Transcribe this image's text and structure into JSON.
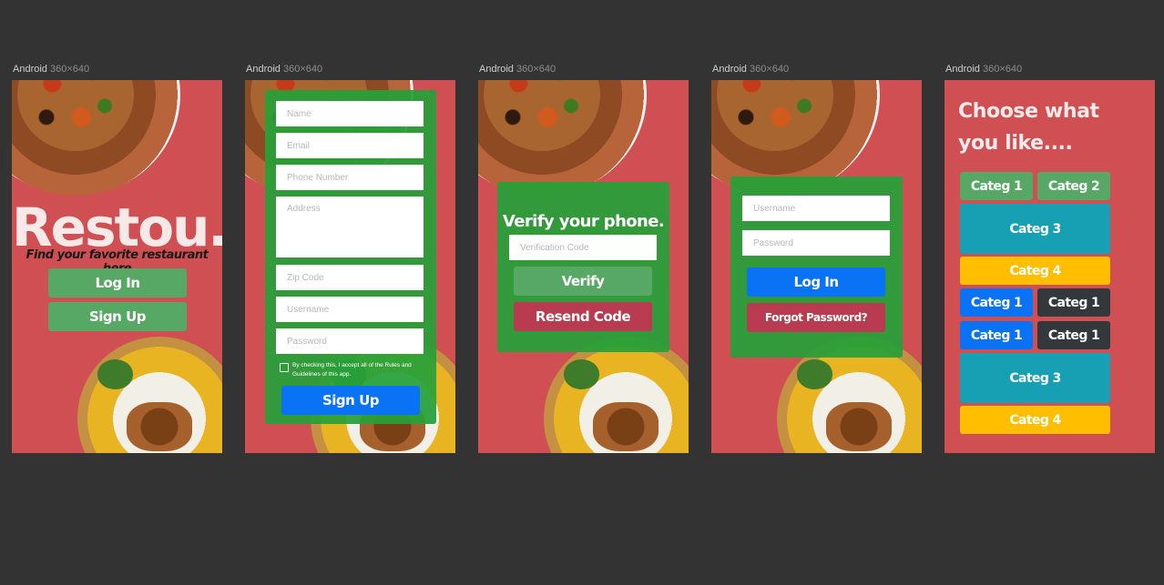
{
  "frames": [
    {
      "device": "Android",
      "size": "360×640"
    },
    {
      "device": "Android",
      "size": "360×640"
    },
    {
      "device": "Android",
      "size": "360×640"
    },
    {
      "device": "Android",
      "size": "360×640"
    },
    {
      "device": "Android",
      "size": "360×640"
    }
  ],
  "splash": {
    "brand": "Restou.",
    "tagline": "Find your favorite restaurant here",
    "login_label": "Log In",
    "signup_label": "Sign Up"
  },
  "signup": {
    "name_placeholder": "Name",
    "email_placeholder": "Email",
    "phone_placeholder": "Phone Number",
    "address_placeholder": "Address",
    "zip_placeholder": "Zip Code",
    "username_placeholder": "Username",
    "password_placeholder": "Password",
    "terms_text": "By checking this, I accept all of the Rules and Guidelines of this app.",
    "submit_label": "Sign Up"
  },
  "verify": {
    "title": "Verify your phone.",
    "code_placeholder": "Verification Code",
    "verify_label": "Verify",
    "resend_label": "Resend Code"
  },
  "login": {
    "username_placeholder": "Username",
    "password_placeholder": "Password",
    "login_label": "Log In",
    "forgot_label": "Forgot Password?"
  },
  "categories": {
    "title_line1": "Choose what",
    "title_line2": "you like....",
    "items": [
      {
        "label": "Categ 1",
        "color": "#57a765"
      },
      {
        "label": "Categ 2",
        "color": "#57a765"
      },
      {
        "label": "Categ 3",
        "color": "#17a0b4"
      },
      {
        "label": "Categ 4",
        "color": "#ffbf00"
      },
      {
        "label": "Categ 1",
        "color": "#0a72f5"
      },
      {
        "label": "Categ 1",
        "color": "#33383d"
      },
      {
        "label": "Categ 1",
        "color": "#0a72f5"
      },
      {
        "label": "Categ 1",
        "color": "#33383d"
      },
      {
        "label": "Categ 3",
        "color": "#17a0b4"
      },
      {
        "label": "Categ 4",
        "color": "#ffbf00"
      }
    ]
  },
  "colors": {
    "background": "#333333",
    "frame": "#cf4f52",
    "panel_green": "#26a038",
    "button_green": "#57a765",
    "button_blue": "#0a72f5",
    "button_maroon": "#b83b4f"
  }
}
